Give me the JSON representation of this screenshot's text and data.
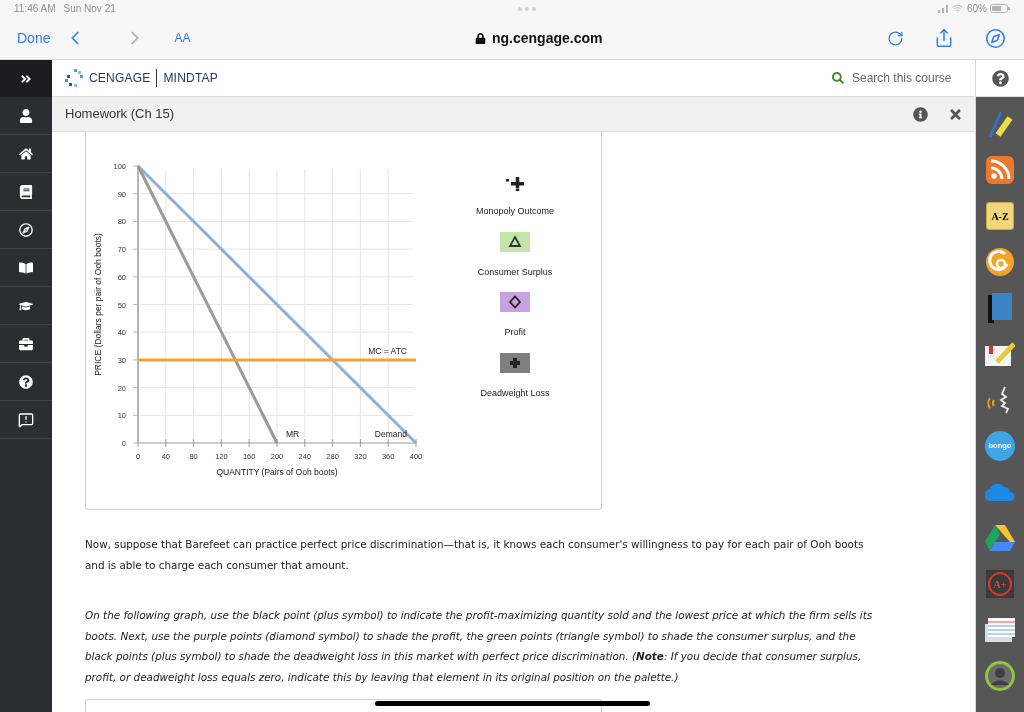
{
  "status_bar": {
    "time": "11:46 AM",
    "date": "Sun Nov 21",
    "battery": "60%"
  },
  "browser_bar": {
    "done": "Done",
    "text_size": "AA",
    "url": "ng.cengage.com"
  },
  "header": {
    "brand": "CENGAGE",
    "product": "MINDTAP",
    "search": {
      "placeholder": "Search this course"
    }
  },
  "assignment": {
    "title": "Homework (Ch 15)"
  },
  "graph": {
    "chart_data": [
      {
        "type": "line",
        "xlabel": "QUANTITY (Pairs of Ooh boots)",
        "ylabel": "PRICE (Dollars per pair of Ooh boots)",
        "xlim": [
          0,
          400
        ],
        "ylim": [
          0,
          100
        ],
        "xticks": [
          0,
          40,
          80,
          120,
          160,
          200,
          240,
          280,
          320,
          360,
          400
        ],
        "yticks": [
          0,
          10,
          20,
          30,
          40,
          50,
          60,
          70,
          80,
          90,
          100
        ],
        "grid": true,
        "series": [
          {
            "name": "Demand",
            "color": "#8db0d4",
            "x": [
              0,
              400
            ],
            "values": [
              100,
              0
            ]
          },
          {
            "name": "MR",
            "color": "#9a9a9a",
            "x": [
              0,
              200
            ],
            "values": [
              100,
              0
            ]
          },
          {
            "name": "MC = ATC",
            "color": "#f4a236",
            "x": [
              0,
              400
            ],
            "values": [
              30,
              30
            ]
          }
        ]
      }
    ],
    "palette": [
      {
        "kind": "point",
        "label": "Monopoly Outcome"
      },
      {
        "kind": "triangle",
        "color": "#c4e5a8",
        "label": "Consumer Surplus"
      },
      {
        "kind": "diamond",
        "color": "#c8a2e0",
        "label": "Profit"
      },
      {
        "kind": "plus",
        "color": "#7f7f7f",
        "label": "Deadweight Loss"
      }
    ]
  },
  "paragraphs": [
    {
      "kind": "intro",
      "text": "Now, suppose that Barefeet can practice perfect price discrimination—that is, it knows each consumer's willingness to pay for each pair of Ooh boots and is able to charge each consumer that amount."
    },
    {
      "kind": "task",
      "text": "On the following graph, use the black point (plus symbol) to indicate the profit-maximizing quantity sold and the lowest price at which the firm sells its boots. Next, use the purple points (diamond symbol) to shade the profit, the green points (triangle symbol) to shade the consumer surplus, and the black points (plus symbol) to shade the deadweight loss in this market with perfect price discrimination. (**Note**: If you decide that consumer surplus, profit, or deadweight loss equals zero, indicate this by leaving that element in its original position on the palette.)"
    }
  ],
  "right_sidebar": {
    "tools": [
      {
        "kind": "pencil"
      },
      {
        "kind": "rss"
      },
      {
        "kind": "glossary",
        "text": "A-Z"
      },
      {
        "kind": "swirl"
      },
      {
        "kind": "book"
      },
      {
        "kind": "notes"
      },
      {
        "kind": "speech"
      },
      {
        "kind": "bongo",
        "text": "bongo"
      },
      {
        "kind": "cloud"
      },
      {
        "kind": "drive"
      },
      {
        "kind": "grade",
        "text": "A+"
      },
      {
        "kind": "cards"
      },
      {
        "kind": "avatar"
      }
    ]
  }
}
